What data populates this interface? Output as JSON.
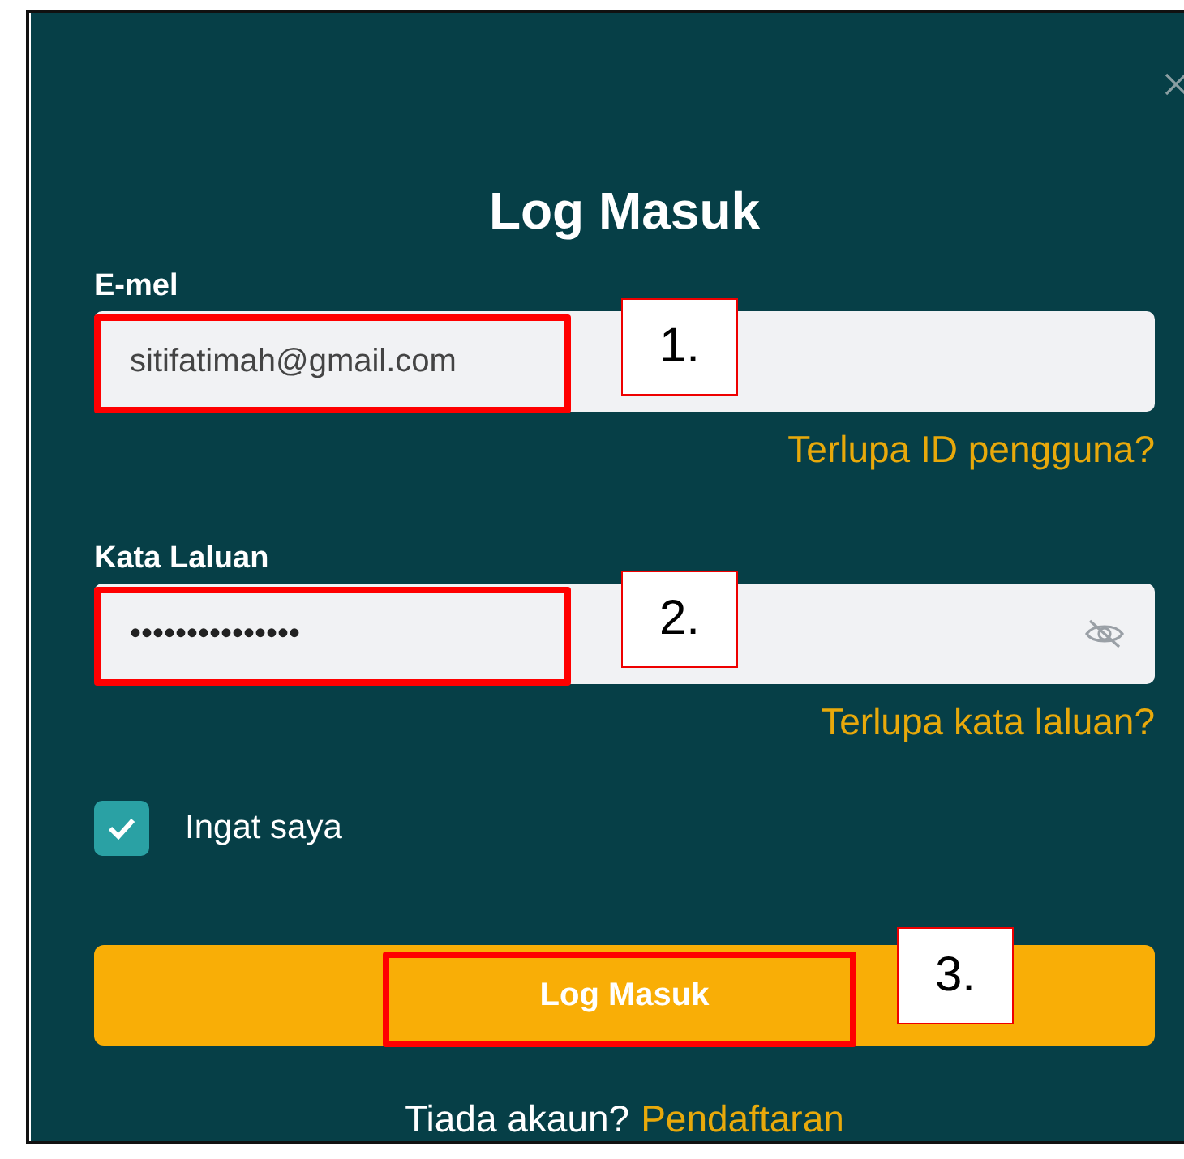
{
  "dialog": {
    "title": "Log Masuk"
  },
  "fields": [
    {
      "kind": "text",
      "label": "E-mel",
      "value": "sitifatimah@gmail.com",
      "link": "Terlupa ID pengguna?",
      "annotation": "1."
    },
    {
      "kind": "password",
      "label": "Kata Laluan",
      "value": "•••••••••••••••",
      "link": "Terlupa kata laluan?",
      "annotation": "2."
    }
  ],
  "remember": {
    "label": "Ingat saya",
    "checked": true
  },
  "submit": {
    "label": "Log Masuk",
    "annotation": "3."
  },
  "footer": {
    "text": "Tiada akaun?",
    "link": "Pendaftaran"
  }
}
